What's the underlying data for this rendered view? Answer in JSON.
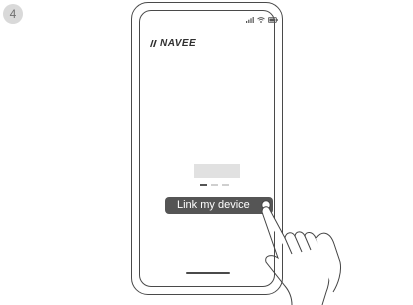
{
  "step": {
    "number": "4"
  },
  "brand": {
    "name": "NAVEE"
  },
  "main": {
    "link_button_label": "Link my device"
  },
  "colors": {
    "button_bg": "#555555",
    "button_text": "#ffffff",
    "outline": "#4a4a4a"
  },
  "icons": {
    "status": [
      "signal-icon",
      "wifi-icon",
      "battery-icon"
    ],
    "logo": "navee-logo-icon",
    "pointer": "hand-pointer-icon"
  }
}
